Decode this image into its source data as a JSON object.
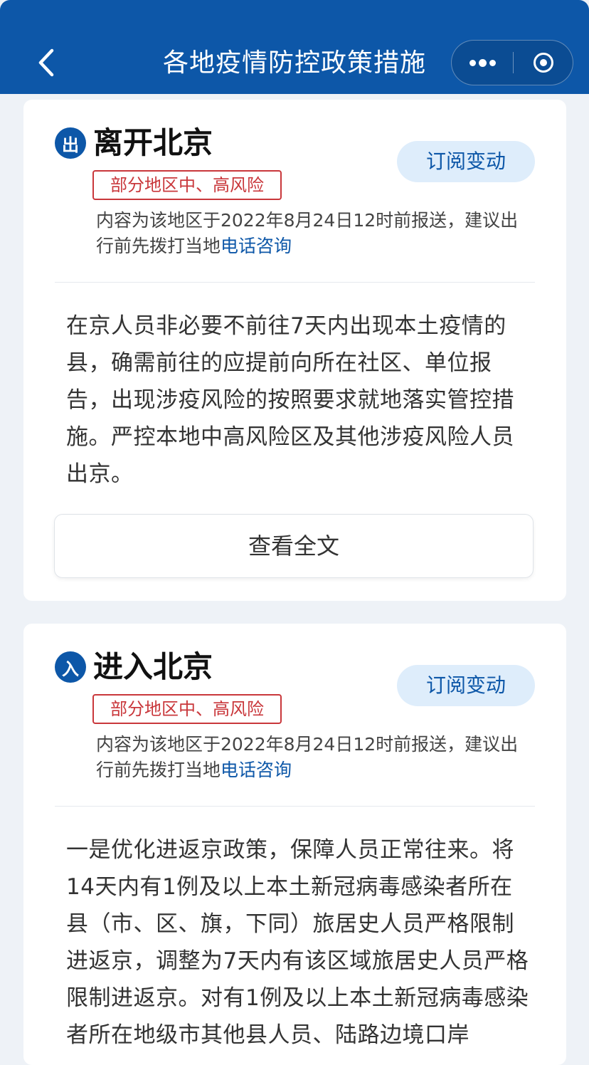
{
  "header": {
    "title": "各地疫情防控政策措施"
  },
  "leave_card": {
    "badge": "出",
    "heading": "离开北京",
    "risk_tag": "部分地区中、高风险",
    "subscribe_label": "订阅变动",
    "info_text": "内容为该地区于2022年8月24日12时前报送，建议出行前先拨打当地",
    "info_link": "电话咨询",
    "body_text": "在京人员非必要不前往7天内出现本土疫情的县，确需前往的应提前向所在社区、单位报告，出现涉疫风险的按照要求就地落实管控措施。严控本地中高风险区及其他涉疫风险人员出京。",
    "view_full_label": "查看全文"
  },
  "enter_card": {
    "badge": "入",
    "heading": "进入北京",
    "risk_tag": "部分地区中、高风险",
    "subscribe_label": "订阅变动",
    "info_text": "内容为该地区于2022年8月24日12时前报送，建议出行前先拨打当地",
    "info_link": "电话咨询",
    "body_text": "一是优化进返京政策，保障人员正常往来。将14天内有1例及以上本土新冠病毒感染者所在县（市、区、旗，下同）旅居史人员严格限制进返京，调整为7天内有该区域旅居史人员严格限制进返京。对有1例及以上本土新冠病毒感染者所在地级市其他县人员、陆路边境口岸"
  }
}
